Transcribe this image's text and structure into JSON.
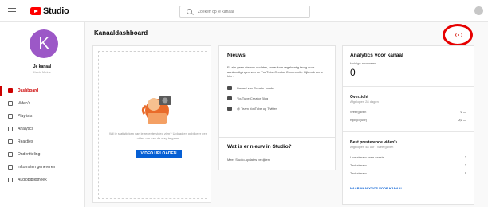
{
  "topbar": {
    "logo_text": "Studio",
    "search_placeholder": "Zoeken op je kanaal"
  },
  "sidebar": {
    "avatar_letter": "K",
    "channel_name": "Je kanaal",
    "channel_sub": "Kevin Meine",
    "items": [
      {
        "label": "Dashboard",
        "icon": "dashboard-icon",
        "active": true
      },
      {
        "label": "Video's",
        "icon": "videos-icon"
      },
      {
        "label": "Playlists",
        "icon": "playlists-icon"
      },
      {
        "label": "Analytics",
        "icon": "analytics-icon"
      },
      {
        "label": "Reacties",
        "icon": "comments-icon"
      },
      {
        "label": "Ondertiteling",
        "icon": "subtitles-icon"
      },
      {
        "label": "Inkomsten genereren",
        "icon": "monetization-icon"
      },
      {
        "label": "Audiobibliotheek",
        "icon": "audio-library-icon"
      }
    ]
  },
  "main": {
    "title": "Kanaaldashboard",
    "upload": {
      "text": "Wil je statistieken van je recente video zien? Upload en publiceer een video om aan de slag te gaan.",
      "button": "VIDEO UPLOADEN"
    },
    "news": {
      "title": "Nieuws",
      "body": "Er zijn geen nieuwe updates, maar kom regelmatig terug voor aankondigingen van de YouTube Creator Community. Kijk ook eens hier:",
      "links": [
        {
          "label": "Kanaal van Creator Insider",
          "icon": "youtube-icon"
        },
        {
          "label": "YouTube Creator Blog",
          "icon": "blog-icon"
        },
        {
          "label": "@ Team YouTube op Twitter",
          "icon": "twitter-icon"
        }
      ]
    },
    "studio": {
      "title": "Wat is er nieuw in Studio?",
      "text": "Meer Studio-updates bekijken"
    },
    "analytics": {
      "title": "Analytics voor kanaal",
      "subs_label": "Huidige abonnees",
      "subs_value": "0",
      "overview_title": "Overzicht",
      "overview_sub": "Afgelopen 28 dagen",
      "rows": [
        {
          "label": "Weergaven",
          "value": "0 —"
        },
        {
          "label": "Kijktijd (uur)",
          "value": "0,0 —"
        }
      ],
      "top_title": "Best presterende video's",
      "top_sub": "Afgelopen 48 uur · Weergaven",
      "top_rows": [
        {
          "label": "Live stream twee sessie",
          "value": "2"
        },
        {
          "label": "Test stream",
          "value": "2"
        },
        {
          "label": "Test stream",
          "value": "1"
        }
      ],
      "link": "NAAR ANALYTICS VOOR KANAAL"
    }
  },
  "colors": {
    "accent": "#cc0000",
    "primary_button": "#065fd4",
    "avatar": "#9c58c7",
    "highlight_ring": "#e60000"
  }
}
